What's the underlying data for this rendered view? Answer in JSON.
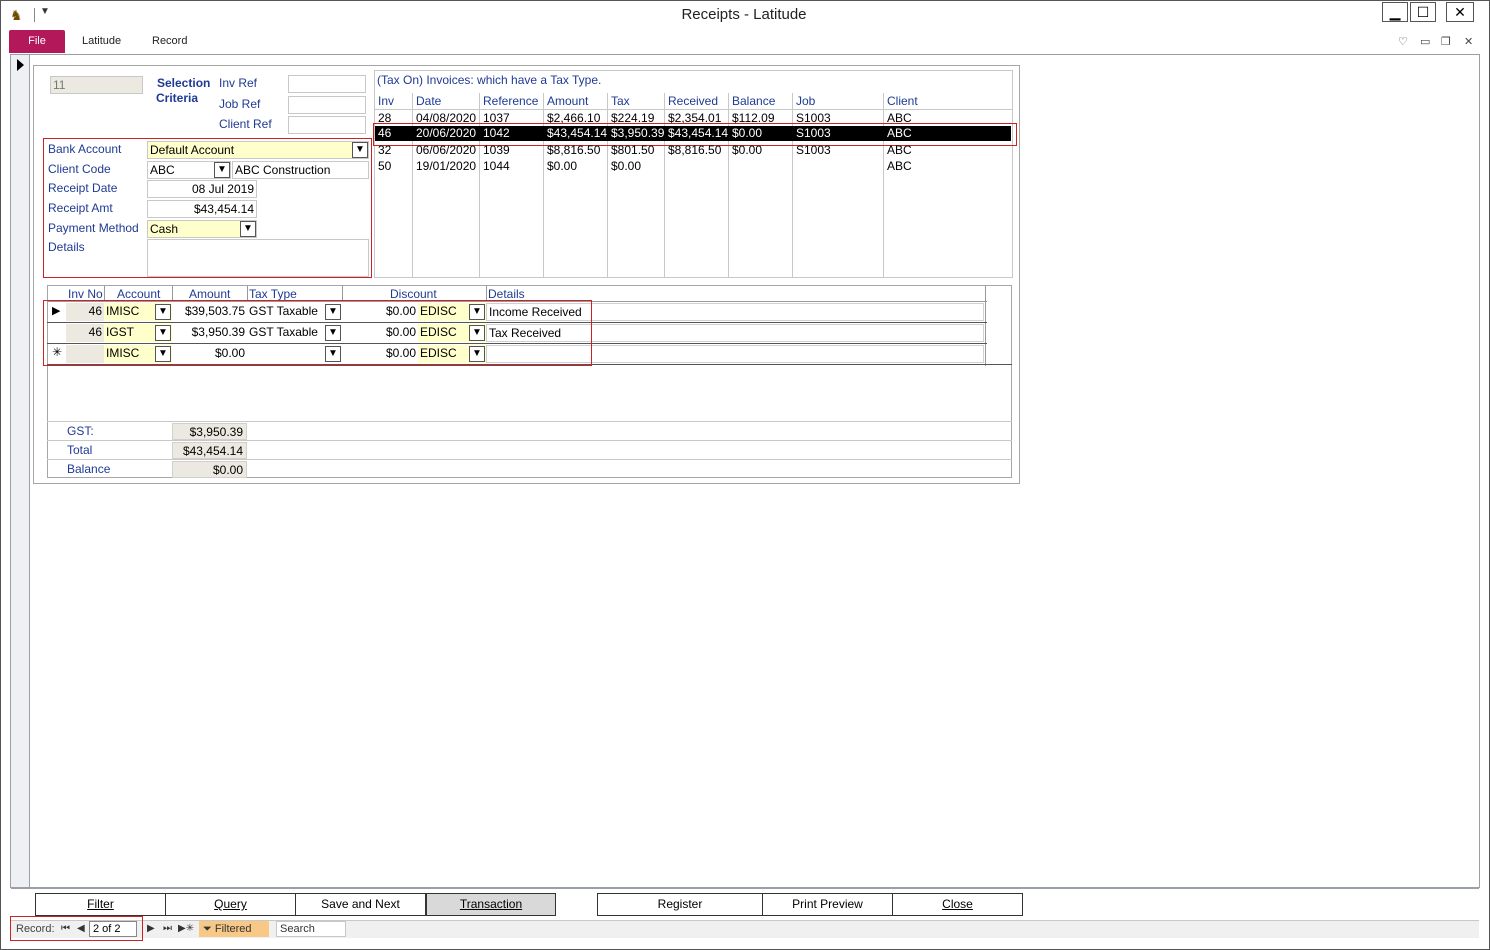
{
  "window": {
    "title": "Receipts - Latitude",
    "minimize": "▁",
    "maximize": "☐",
    "close": "✕"
  },
  "ribbon": {
    "tabs": [
      "File",
      "Latitude",
      "Record"
    ],
    "controls": [
      "♡",
      "▭",
      "❐",
      "✕"
    ]
  },
  "form": {
    "record_id": "11",
    "selection_criteria": "Selection Criteria",
    "selection_line1": "Selection",
    "selection_line2": "Criteria",
    "inv_ref_label": "Inv Ref",
    "job_ref_label": "Job Ref",
    "client_ref_label": "Client Ref",
    "bank_account_label": "Bank Account",
    "bank_account_value": "Default Account",
    "client_code_label": "Client Code",
    "client_code_value": "ABC",
    "client_name_value": "ABC Construction",
    "receipt_date_label": "Receipt Date",
    "receipt_date_value": "08 Jul 2019",
    "receipt_amt_label": "Receipt Amt",
    "receipt_amt_value": "$43,454.14",
    "payment_method_label": "Payment Method",
    "payment_method_value": "Cash",
    "details_label": "Details"
  },
  "invoices": {
    "caption": "(Tax On) Invoices: which have a Tax Type.",
    "columns": [
      "Inv",
      "Date",
      "Reference",
      "Amount",
      "Tax",
      "Received",
      "Balance",
      "Job",
      "Client"
    ],
    "rows": [
      [
        "28",
        "04/08/2020",
        "1037",
        "$2,466.10",
        "$224.19",
        "$2,354.01",
        "$112.09",
        "S1003",
        "ABC"
      ],
      [
        "46",
        "20/06/2020",
        "1042",
        "$43,454.14",
        "$3,950.39",
        "$43,454.14",
        "$0.00",
        "S1003",
        "ABC"
      ],
      [
        "32",
        "06/06/2020",
        "1039",
        "$8,816.50",
        "$801.50",
        "$8,816.50",
        "$0.00",
        "S1003",
        "ABC"
      ],
      [
        "50",
        "19/01/2020",
        "1044",
        "$0.00",
        "$0.00",
        "",
        "",
        "",
        "ABC"
      ]
    ],
    "selected_index": 1
  },
  "lines": {
    "columns": [
      "Inv No",
      "Account",
      "Amount",
      "Tax Type",
      "Discount",
      "Details"
    ],
    "rows": [
      {
        "selector": "▶",
        "inv_no": "46",
        "account": "IMISC",
        "amount": "$39,503.75",
        "tax_type": "GST Taxable",
        "discount": "$0.00",
        "disc_code": "EDISC",
        "details": "Income Received"
      },
      {
        "selector": "",
        "inv_no": "46",
        "account": "IGST",
        "amount": "$3,950.39",
        "tax_type": "GST Taxable",
        "discount": "$0.00",
        "disc_code": "EDISC",
        "details": "Tax Received"
      },
      {
        "selector": "✳",
        "inv_no": "",
        "account": "IMISC",
        "amount": "$0.00",
        "tax_type": "",
        "discount": "$0.00",
        "disc_code": "EDISC",
        "details": ""
      }
    ]
  },
  "totals": {
    "gst_label": "GST:",
    "gst_value": "$3,950.39",
    "total_label": "Total",
    "total_value": "$43,454.14",
    "balance_label": "Balance",
    "balance_value": "$0.00"
  },
  "buttons": {
    "filter": "Filter",
    "query": "Query",
    "save_next": "Save and Next",
    "transaction": "Transaction",
    "register": "Register",
    "print_preview": "Print Preview",
    "close": "Close"
  },
  "nav": {
    "record_label": "Record:",
    "record_value": "2 of 2",
    "filtered": "Filtered",
    "search": "Search",
    "first": "⏮",
    "prev": "◀",
    "next": "▶",
    "last": "⏭",
    "new": "▶✳"
  },
  "colors": {
    "file_tab": "#b3185a",
    "highlight_field": "#ffffcc",
    "label_text": "#1f3a93",
    "annotation_red": "#cc2222",
    "filtered_badge": "#f7c886"
  }
}
